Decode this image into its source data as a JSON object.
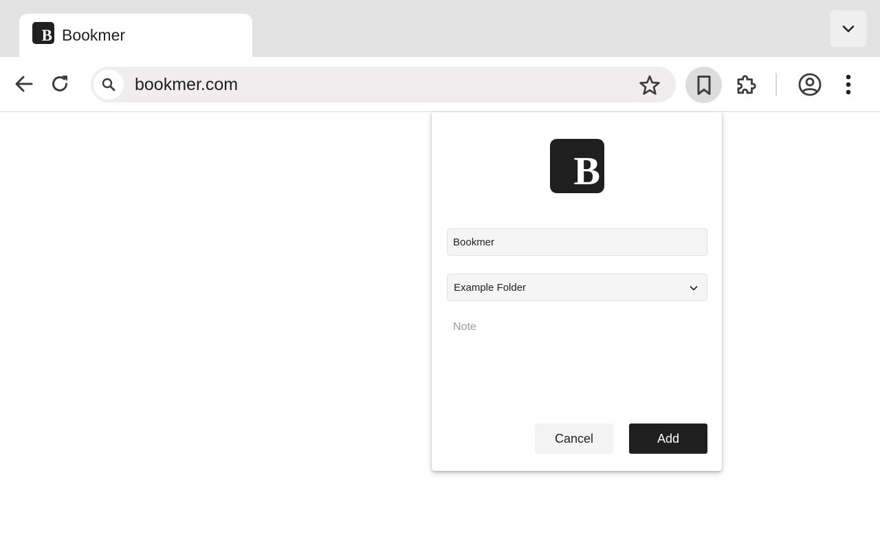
{
  "tab": {
    "title": "Bookmer",
    "favicon_letter": "B"
  },
  "omnibox": {
    "url": "bookmer.com"
  },
  "icons": {
    "back": "arrow-left-icon",
    "reload": "reload-icon",
    "search": "search-icon",
    "star": "star-outline-icon",
    "bookmark": "bookmark-icon",
    "extensions": "puzzle-icon",
    "profile": "account-circle-icon",
    "menu": "more-vert-icon",
    "tab_search": "chevron-down-icon"
  },
  "popup": {
    "logo_letter": "B",
    "name_value": "Bookmer",
    "folder_value": "Example Folder",
    "note_placeholder": "Note",
    "cancel_label": "Cancel",
    "add_label": "Add"
  },
  "colors": {
    "tabstrip": "#e3e3e3",
    "omnibox": "#efeded",
    "primary_button": "#1f1f1f",
    "logo_bg": "#1f1f1f"
  }
}
